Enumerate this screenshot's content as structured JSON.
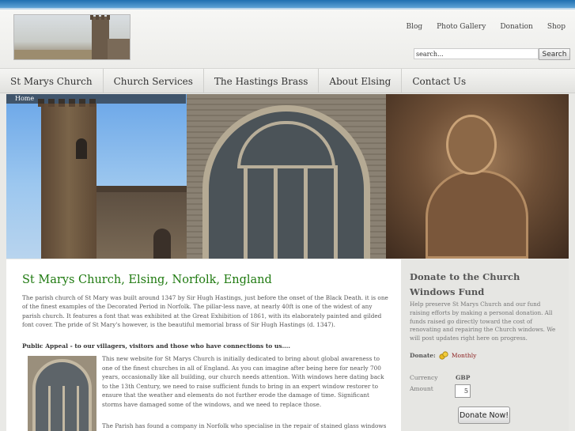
{
  "header": {
    "top_links": [
      "Blog",
      "Photo Gallery",
      "Donation",
      "Shop"
    ],
    "search": {
      "placeholder": "search...",
      "button_label": "Search"
    }
  },
  "nav": {
    "items": [
      "St Marys Church",
      "Church Services",
      "The Hastings Brass",
      "About Elsing",
      "Contact Us"
    ]
  },
  "breadcrumb": "Home",
  "main": {
    "title": "St Marys Church, Elsing, Norfolk, England",
    "intro": "The parish church of St Mary was built around 1347 by Sir Hugh Hastings, just before the onset of the Black Death. it is one of the finest examples of the Decorated Period in Norfolk. The pillar-less nave, at nearly 40ft is one of the widest of any parish church.  It features a font that was exhibited at the Great Exhibition of 1861, with its elaborately painted and gilded font cover. The pride of St Mary's however, is the beautiful memorial brass of Sir Hugh Hastings (d. 1347).",
    "appeal_heading": "Public Appeal - to our villagers, visitors and those who have connections to us....",
    "appeal_text": "This new website for St Marys Church is initially dedicated to bring about global awareness to one of the finest churches in all of England.  As you can imagine after being here for nearly 700 years, occasionally like all building, our church needs attention.  With windows here dating back to the 13th Century, we need to raise sufficient funds to bring in an expert window restorer to ensure that the weather and elements do not further erode the damage of time.  Significant storms have damaged some of the windows, and we need to replace those.",
    "appeal_text2": "The Parish has found a company in Norfolk who specialise in the repair of stained glass windows"
  },
  "sidebar": {
    "title": "Donate to the Church Windows Fund",
    "text": "Help preserve St Marys Church and our fund raising efforts by making a personal donation. All funds raised go directly toward the cost of renovating and repairing the Church windows. We will post updates right here on progress.",
    "donate_label": "Donate:",
    "frequency": "Monthly",
    "currency_label": "Currency",
    "currency_value": "GBP",
    "amount_label": "Amount",
    "amount_value": "5",
    "donate_button": "Donate Now!"
  },
  "colors": {
    "title_green": "#1f7a10",
    "top_bar_blue": "#1f6fb0",
    "monthly_red": "#8a1c1c"
  }
}
